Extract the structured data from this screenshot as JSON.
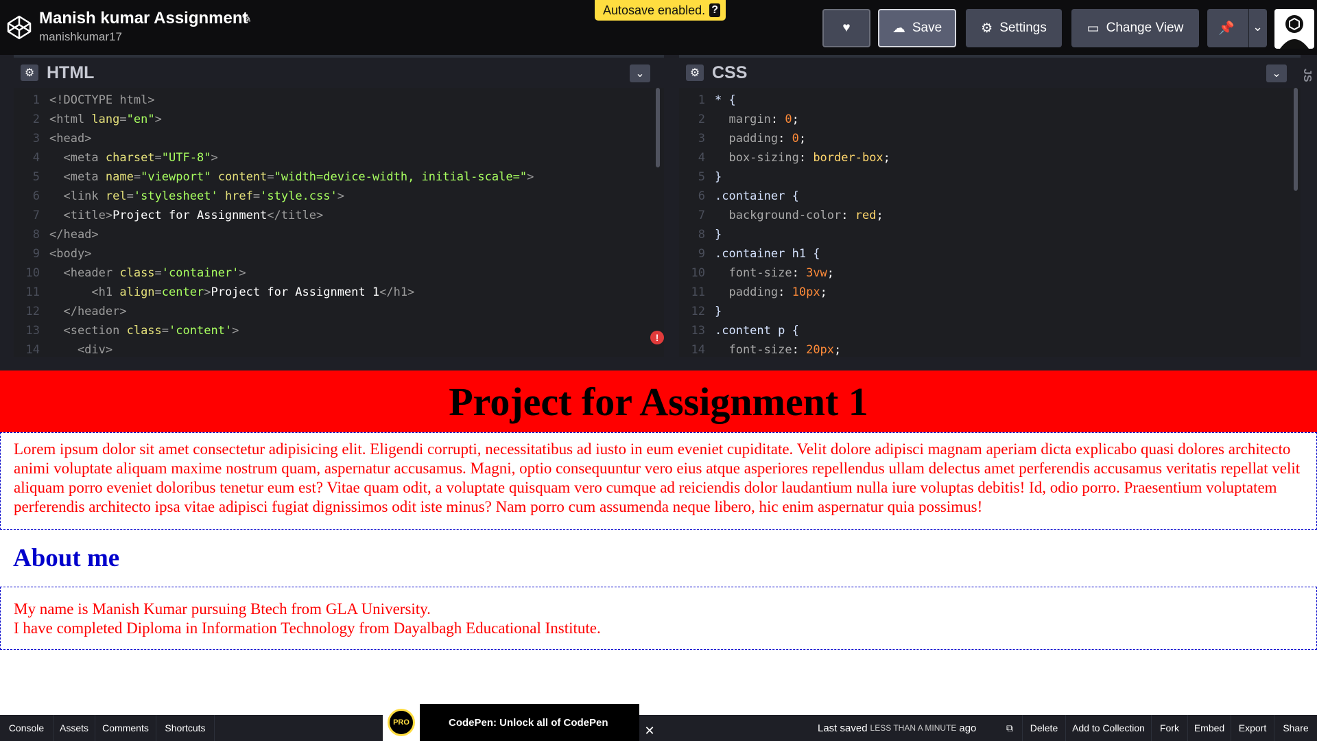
{
  "header": {
    "title": "Manish kumar Assignment",
    "username": "manishkumar17",
    "autosave": "Autosave enabled.",
    "autosave_help": "?",
    "save_label": "Save",
    "settings_label": "Settings",
    "change_view_label": "Change View"
  },
  "editors": {
    "html_title": "HTML",
    "css_title": "CSS",
    "js_title": "JS",
    "html_lines": [
      "<!DOCTYPE html>",
      "<html lang=\"en\">",
      "<head>",
      "  <meta charset=\"UTF-8\">",
      "  <meta name=\"viewport\" content=\"width=device-width, initial-scale=\">",
      "  <link rel='stylesheet' href='style.css'>",
      "  <title>Project for Assignment</title>",
      "</head>",
      "<body>",
      "  <header class='container'>",
      "      <h1 align=center>Project for Assignment 1</h1>",
      "  </header>",
      "  <section class='content'>",
      "    <div>"
    ],
    "css_lines": [
      "* {",
      "  margin: 0;",
      "  padding: 0;",
      "  box-sizing: border-box;",
      "}",
      ".container {",
      "  background-color: red;",
      "}",
      ".container h1 {",
      "  font-size: 3vw;",
      "  padding: 10px;",
      "}",
      ".content p {",
      "  font-size: 20px;"
    ]
  },
  "preview": {
    "heading": "Project for Assignment 1",
    "paragraph": "Lorem ipsum dolor sit amet consectetur adipisicing elit. Eligendi corrupti, necessitatibus ad iusto in eum eveniet cupiditate. Velit dolore adipisci magnam aperiam dicta explicabo quasi dolores architecto animi voluptate aliquam maxime nostrum quam, aspernatur accusamus. Magni, optio consequuntur vero eius atque asperiores repellendus ullam delectus amet perferendis accusamus veritatis repellat velit aliquam porro eveniet doloribus tenetur eum est? Vitae quam odit, a voluptate quisquam vero cumque ad reiciendis dolor laudantium nulla iure voluptas debitis! Id, odio porro. Praesentium voluptatem perferendis architecto ipsa vitae adipisci fugiat dignissimos odit iste minus? Nam porro cum assumenda neque libero, hic enim aspernatur quia possimus!",
    "about_heading": "About me",
    "about_line1": "My name is Manish Kumar pursuing Btech from GLA University.",
    "about_line2": "I have completed Diploma in Information Technology from Dayalbagh Educational Institute."
  },
  "footer": {
    "console": "Console",
    "assets": "Assets",
    "comments": "Comments",
    "shortcuts": "Shortcuts",
    "promo_badge": "PRO",
    "promo_text": "CodePen: Unlock all of CodePen",
    "last_saved_prefix": "Last saved",
    "last_saved_time": "LESS THAN A MINUTE",
    "last_saved_suffix": "ago",
    "delete": "Delete",
    "add_to_collection": "Add to Collection",
    "fork": "Fork",
    "embed": "Embed",
    "export": "Export",
    "share": "Share"
  },
  "colors": {
    "accent_yellow": "#ffdd40",
    "preview_header_bg": "#ff0000",
    "preview_text": "#ff0000",
    "preview_about": "#0000cc"
  }
}
